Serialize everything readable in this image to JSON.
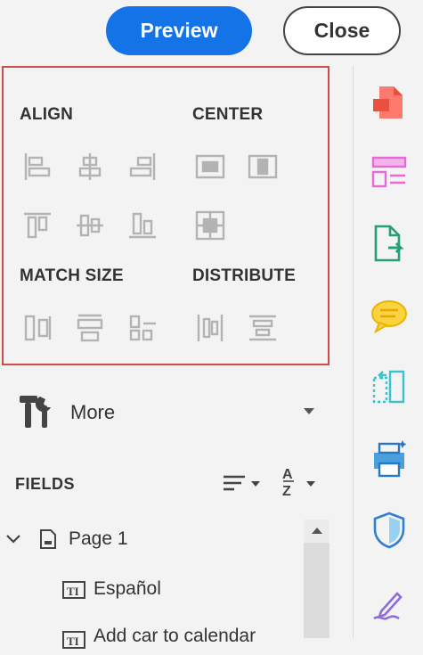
{
  "header": {
    "preview_label": "Preview",
    "close_label": "Close"
  },
  "align_panel": {
    "align_title": "ALIGN",
    "center_title": "CENTER",
    "match_size_title": "MATCH SIZE",
    "distribute_title": "DISTRIBUTE"
  },
  "more": {
    "label": "More"
  },
  "fields": {
    "title": "FIELDS",
    "tree": [
      {
        "label": "Page 1"
      },
      {
        "label": "Español"
      },
      {
        "label": "Add car to calendar"
      }
    ]
  },
  "colors": {
    "accent": "#1473e6",
    "selection_border": "#d54a4a",
    "tool_icon": "#b3b3b3"
  }
}
